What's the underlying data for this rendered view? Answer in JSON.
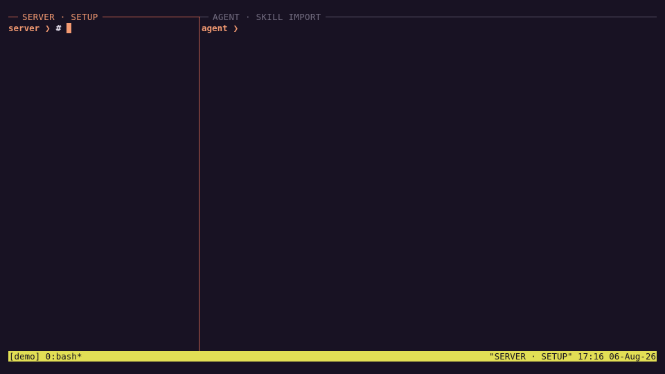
{
  "left_pane": {
    "title": "SERVER · SETUP",
    "prompt_user": "server",
    "prompt_arrow": "❯",
    "prompt_symbol": "#"
  },
  "right_pane": {
    "title": "AGENT · SKILL IMPORT",
    "prompt_user": "agent",
    "prompt_arrow": "❯"
  },
  "status_bar": {
    "left": "[demo] 0:bash*",
    "right": "\"SERVER · SETUP\" 17:16 06-Aug-26"
  },
  "colors": {
    "background": "#181223",
    "active_accent": "#f39a72",
    "inactive_text": "#736d81",
    "status_bar": "#e2df55"
  }
}
